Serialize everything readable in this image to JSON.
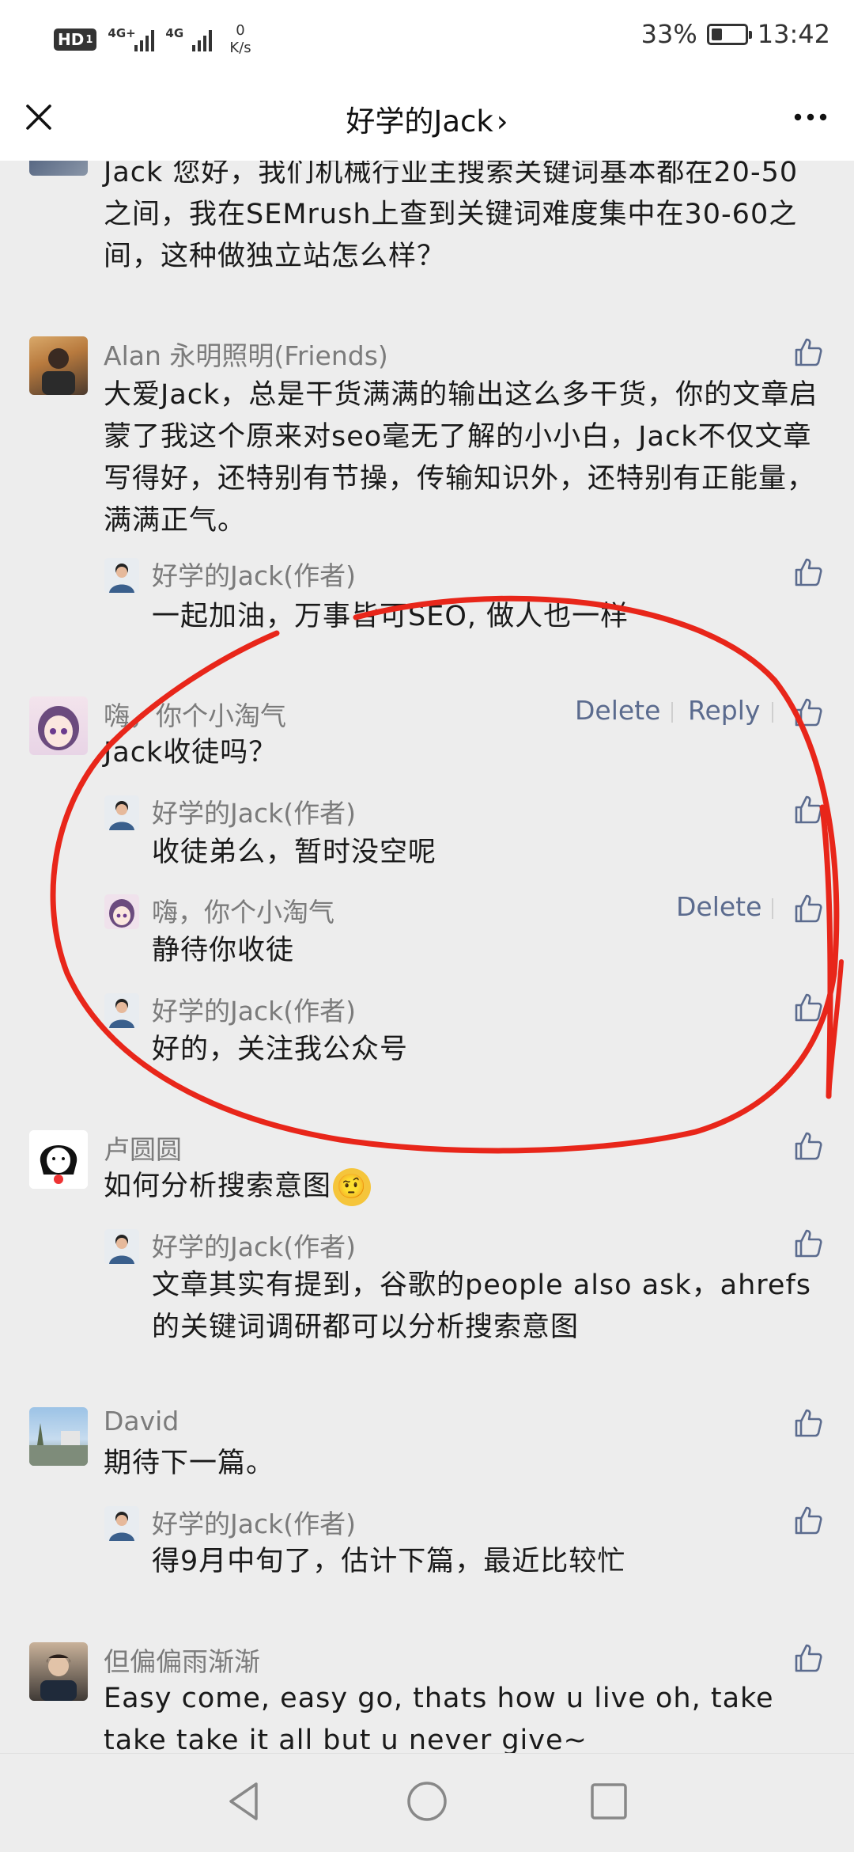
{
  "status_bar": {
    "hd": "HD",
    "hd_sub": "1",
    "signal1_label": "4G+",
    "signal2_label": "4G",
    "net_speed": "0",
    "net_unit": "K/s",
    "battery": "33%",
    "battery_level": 0.33,
    "time": "13:42"
  },
  "nav": {
    "title": "好学的Jack",
    "chevron": "›",
    "close_icon": "close-icon",
    "more_icon": "more-icon"
  },
  "comments": [
    {
      "text": "Jack 您好，我们机械行业主搜索关键词基本都在20-50之间，我在SEMrush上查到关键词难度集中在30-60之间，这种做独立站怎么样？"
    },
    {
      "name": "Alan 永明照明(Friends)",
      "text": "大爱Jack，总是干货满满的输出这么多干货，你的文章启蒙了我这个原来对seo毫无了解的小小白，Jack不仅文章写得好，还特别有节操，传输知识外，还特别有正能量，满满正气。",
      "replies": [
        {
          "name": "好学的Jack(作者)",
          "text": "一起加油，万事皆可SEO, 做人也一样"
        }
      ]
    },
    {
      "name": "嗨，你个小淘气",
      "delete": "Delete",
      "reply": "Reply",
      "text": "Jack收徒吗？",
      "replies": [
        {
          "name": "好学的Jack(作者)",
          "text": "收徒弟么，暂时没空呢"
        },
        {
          "name": "嗨，你个小淘气",
          "delete": "Delete",
          "text": "静待你收徒"
        },
        {
          "name": "好学的Jack(作者)",
          "text": "好的，关注我公众号"
        }
      ]
    },
    {
      "name": "卢圆圆",
      "text": "如何分析搜索意图",
      "emoji": "🤨",
      "replies": [
        {
          "name": "好学的Jack(作者)",
          "text": "文章其实有提到，谷歌的people also ask，ahrefs的关键词调研都可以分析搜索意图"
        }
      ]
    },
    {
      "name": "David",
      "text": "期待下一篇。",
      "replies": [
        {
          "name": "好学的Jack(作者)",
          "text": "得9月中旬了，估计下篇，最近比较忙"
        }
      ]
    },
    {
      "name": "但偏偏雨渐渐",
      "text": "Easy come, easy go, thats how u live oh, take take take it all but u never give~"
    }
  ],
  "colors": {
    "background": "#ededed",
    "action_blue": "#5b6b8e",
    "annotation_red": "#e8261a",
    "name_gray": "#7b7b7b"
  },
  "system_nav": {
    "back_icon": "back-triangle-icon",
    "home_icon": "home-circle-icon",
    "recents_icon": "recents-square-icon"
  }
}
